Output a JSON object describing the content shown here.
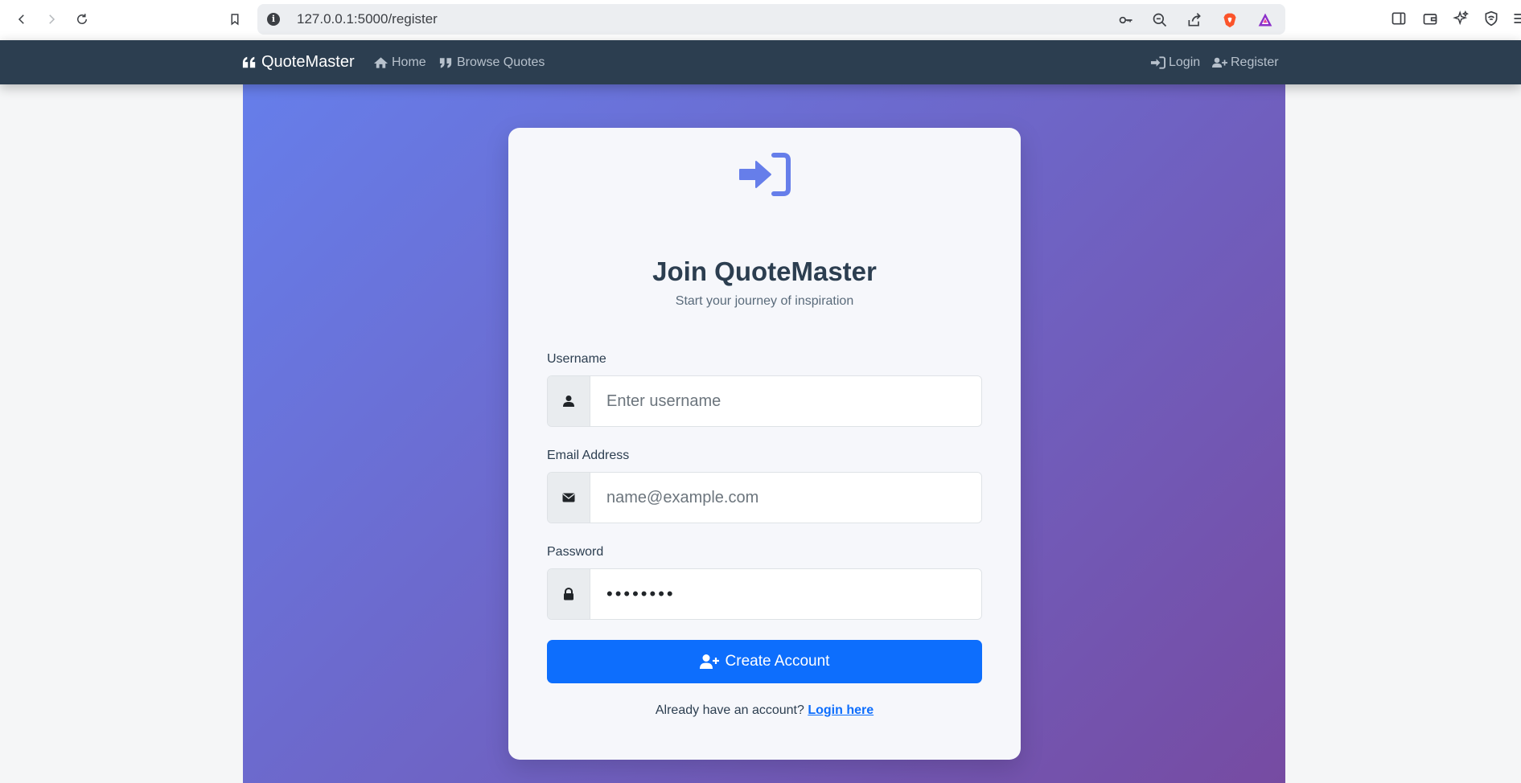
{
  "browser": {
    "url": "127.0.0.1:5000/register"
  },
  "navbar": {
    "brand": "QuoteMaster",
    "links": {
      "home": "Home",
      "browse": "Browse Quotes",
      "login": "Login",
      "register": "Register"
    }
  },
  "card": {
    "title": "Join QuoteMaster",
    "subtitle": "Start your journey of inspiration",
    "fields": {
      "username": {
        "label": "Username",
        "placeholder": "Enter username"
      },
      "email": {
        "label": "Email Address",
        "placeholder": "name@example.com"
      },
      "password": {
        "label": "Password",
        "value": "••••••••"
      }
    },
    "submit_label": "Create Account",
    "footer": {
      "prompt": "Already have an account?",
      "link": "Login here"
    }
  },
  "colors": {
    "navbar_bg": "#2c3e50",
    "gradient_start": "#667eea",
    "gradient_end": "#764ba2",
    "primary": "#0d6efd"
  }
}
